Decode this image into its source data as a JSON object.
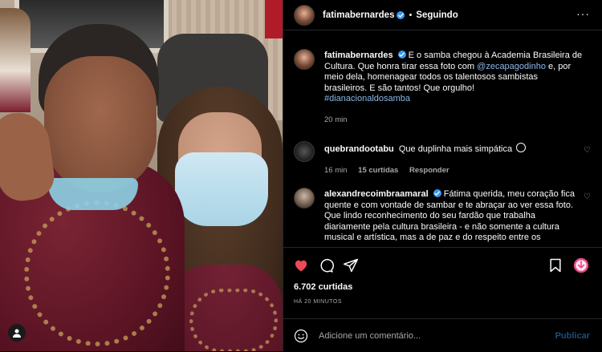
{
  "post_header": {
    "username": "fatimabernardes",
    "separator": "•",
    "follow_status": "Seguindo",
    "more_icon": "more-dots-icon"
  },
  "comments": [
    {
      "username": "fatimabernardes",
      "verified": true,
      "text_before": "E o samba chegou à Academia Brasileira de Cultura. Que honra tirar essa foto com ",
      "mention": "@zecapagodinho",
      "text_after": " e, por meio dela, homenagear todos os talentosos sambistas brasileiros. E são tantos! Que orgulho!",
      "hashtag": "#dianacionaldosamba",
      "time": "20 min"
    },
    {
      "username": "quebrandootabu",
      "verified": false,
      "text": "Que duplinha mais simpática",
      "time": "16 min",
      "likes": "15 curtidas",
      "reply": "Responder"
    },
    {
      "username": "alexandrecoimbraamaral",
      "verified": true,
      "text": "Fátima querida, meu coração fica quente e com vontade de sambar e te abraçar ao ver essa foto. Que lindo reconhecimento do seu fardão que trabalha diariamente pela cultura brasileira - e não somente a cultura musical e artística, mas a de paz e do respeito entre os"
    }
  ],
  "actions": {
    "like_icon": "heart-filled-icon",
    "comment_icon": "comment-bubble-icon",
    "share_icon": "paper-plane-icon",
    "save_icon": "bookmark-icon",
    "extra_icon": "download-arrow-icon"
  },
  "likes": "6.702 curtidas",
  "post_time": "HÁ 20 MINUTOS",
  "add_comment": {
    "placeholder": "Adicione um comentário...",
    "publish": "Publicar"
  },
  "colors": {
    "background": "#000000",
    "text": "#fafafa",
    "secondary": "#a8a8a8",
    "link": "#8ab8e8",
    "like_red": "#ed4956",
    "verified_blue": "#3897f0",
    "publish_disabled": "#1f4f77",
    "extra_icon_pink": "#e8488a"
  }
}
